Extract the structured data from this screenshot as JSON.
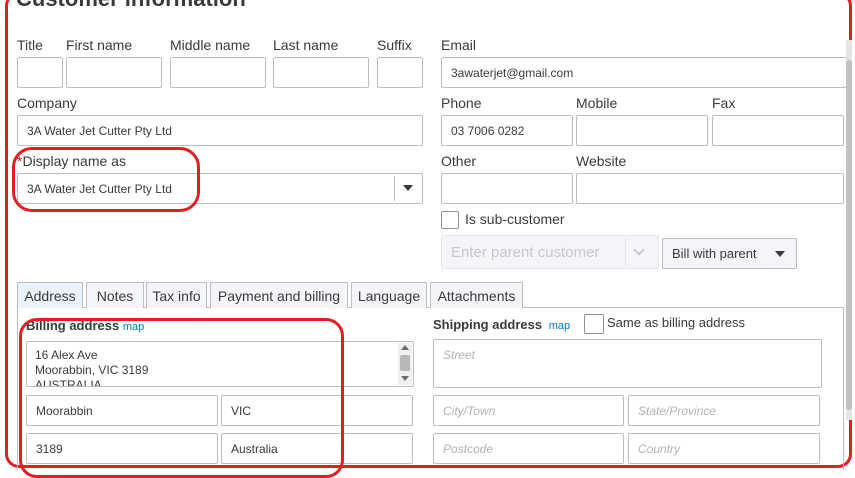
{
  "page": {
    "title": "Customer information"
  },
  "labels": {
    "title": "Title",
    "first_name": "First name",
    "middle_name": "Middle name",
    "last_name": "Last name",
    "suffix": "Suffix",
    "email": "Email",
    "company": "Company",
    "phone": "Phone",
    "mobile": "Mobile",
    "fax": "Fax",
    "display_name": "Display name as",
    "required_marker": "*",
    "other": "Other",
    "website": "Website",
    "sub_customer": "Is sub-customer"
  },
  "values": {
    "title": "",
    "first_name": "",
    "middle_name": "",
    "last_name": "",
    "suffix": "",
    "email": "3awaterjet@gmail.com",
    "company": "3A Water Jet Cutter Pty Ltd",
    "phone": "03 7006 0282",
    "mobile": "",
    "fax": "",
    "display_name": "3A Water Jet Cutter Pty Ltd",
    "other": "",
    "website": ""
  },
  "parent": {
    "placeholder": "Enter parent customer",
    "bill_option": "Bill with parent"
  },
  "tabs": [
    {
      "label": "Address",
      "active": true
    },
    {
      "label": "Notes"
    },
    {
      "label": "Tax info"
    },
    {
      "label": "Payment and billing"
    },
    {
      "label": "Language"
    },
    {
      "label": "Attachments"
    }
  ],
  "billing": {
    "heading": "Billing address",
    "map": "map",
    "street_lines": [
      "16 Alex Ave",
      "Moorabbin, VIC 3189",
      "AUSTRALIA"
    ],
    "city": "Moorabbin",
    "state": "VIC",
    "postcode": "3189",
    "country": "Australia"
  },
  "shipping": {
    "heading": "Shipping address",
    "map": "map",
    "same_as_billing": "Same as billing address",
    "street_placeholder": "Street",
    "city_placeholder": "City/Town",
    "state_placeholder": "State/Province",
    "postcode_placeholder": "Postcode",
    "country_placeholder": "Country"
  },
  "colors": {
    "annotation_red": "#e02020",
    "link_blue": "#0077c5",
    "input_border": "#babec5"
  }
}
